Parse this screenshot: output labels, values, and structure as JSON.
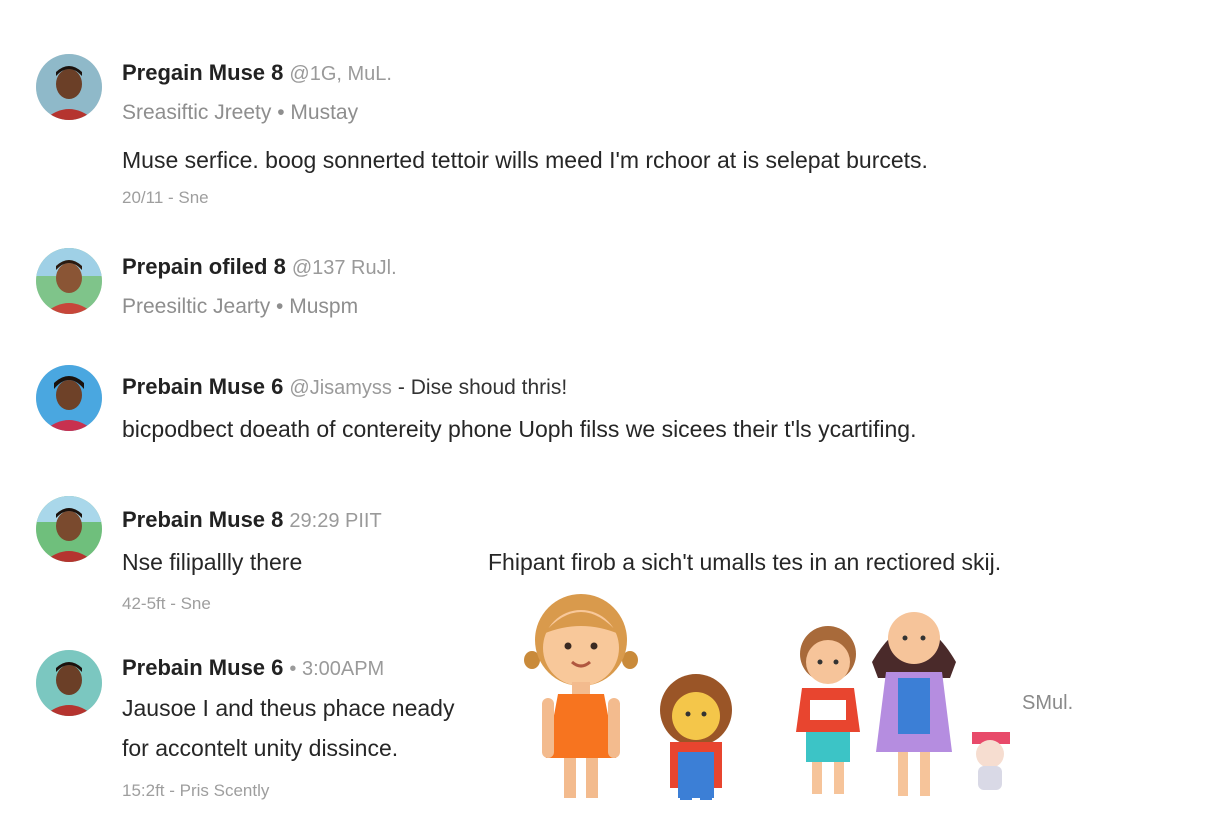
{
  "posts": [
    {
      "name": "Pregain Muse 8",
      "handle": "@1G, MuL.",
      "subtitle": "Sreasiftic Jreety • Mustay",
      "body": "Muse serfice. boog sonnerted tettoir wills meed I'm rchoor at is selepat burcets.",
      "meta": "20/11 - Sne"
    },
    {
      "name": "Prepain ofiled 8",
      "handle": "@137 RuJl.",
      "subtitle": "Preesiltic Jearty • Muspm"
    },
    {
      "name": "Prebain Muse 6",
      "handle": "@Jisamyss",
      "handle_extra": "- Dise shoud thris!",
      "body": "bicpodbect doeath of contereity phone Uoph filss we sicees their t'ls ycartifing."
    },
    {
      "name": "Prebain Muse 8",
      "handle": "29:29 PIIT",
      "body_left": "Nse filipallly there",
      "body_right": "Fhipant firob a sich't umalls tes in an rectiored skij.",
      "meta": "42-5ft - Sne"
    },
    {
      "name": "Prebain Muse 6",
      "handle": "• 3:00APM",
      "body_line1": "Jausoe I and theus phace neady",
      "body_line2": "for accontelt unity dissince.",
      "meta": "15:2ft - Pris Scently"
    }
  ],
  "illustration": {
    "label": "SMul.",
    "icon": "children-illustration"
  }
}
